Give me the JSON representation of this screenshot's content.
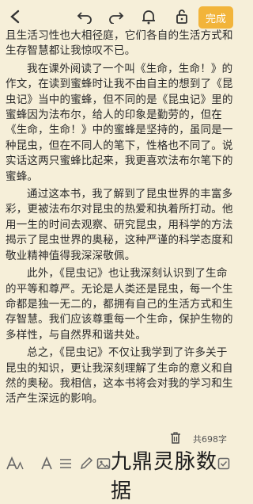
{
  "toolbar": {
    "done_label": "完成",
    "icons": [
      "back-icon",
      "undo-icon",
      "redo-icon",
      "bell-icon",
      "lock-icon"
    ]
  },
  "content": {
    "paragraphs": [
      "且生活习性也大相径庭，它们各自的生活方式和生存智慧都让我惊叹不已。",
      "我在课外阅读了一个叫《生命，生命！》的作文，在读到蜜蜂时让我不由自主的想到了《昆虫记》当中的蜜蜂，但不同的是《昆虫记》里的蜜蜂因为法布尔，给人的印象是勤劳的，但在《生命，生命！》中的蜜蜂是坚持的，虽同是一种昆虫，但在不同人的笔下，性格也不同了。说实话这两只蜜蜂比起来，我更喜欢法布尔笔下的蜜蜂。",
      "通过这本书，我了解到了昆虫世界的丰富多彩，更被法布尔对昆虫的热爱和执着所打动。他用一生的时间去观察、研究昆虫，用科学的方法揭示了昆虫世界的奥秘，这种严谨的科学态度和敬业精神值得我深深敬佩。",
      "此外，《昆虫记》也让我深刻认识到了生命的平等和尊严。无论是人类还是昆虫，每一个生命都是独一无二的，都拥有自己的生活方式和生存智慧。我们应该尊重每一个生命，保护生物的多样性，与自然界和谐共处。",
      "总之，《昆虫记》不仅让我学到了许多关于昆虫的知识，更让我深刻理解了生命的意义和自然的奥秘。我相信，这本书将会对我的学习和生活产生深远的影响。"
    ]
  },
  "footer": {
    "word_count": "共698字"
  },
  "bottom_bar": {
    "icons": [
      "text-format-icon",
      "font-icon",
      "list-icon",
      "pen-icon",
      "image-icon",
      "checkbox-icon"
    ]
  },
  "watermark": "九鼎灵脉数据"
}
